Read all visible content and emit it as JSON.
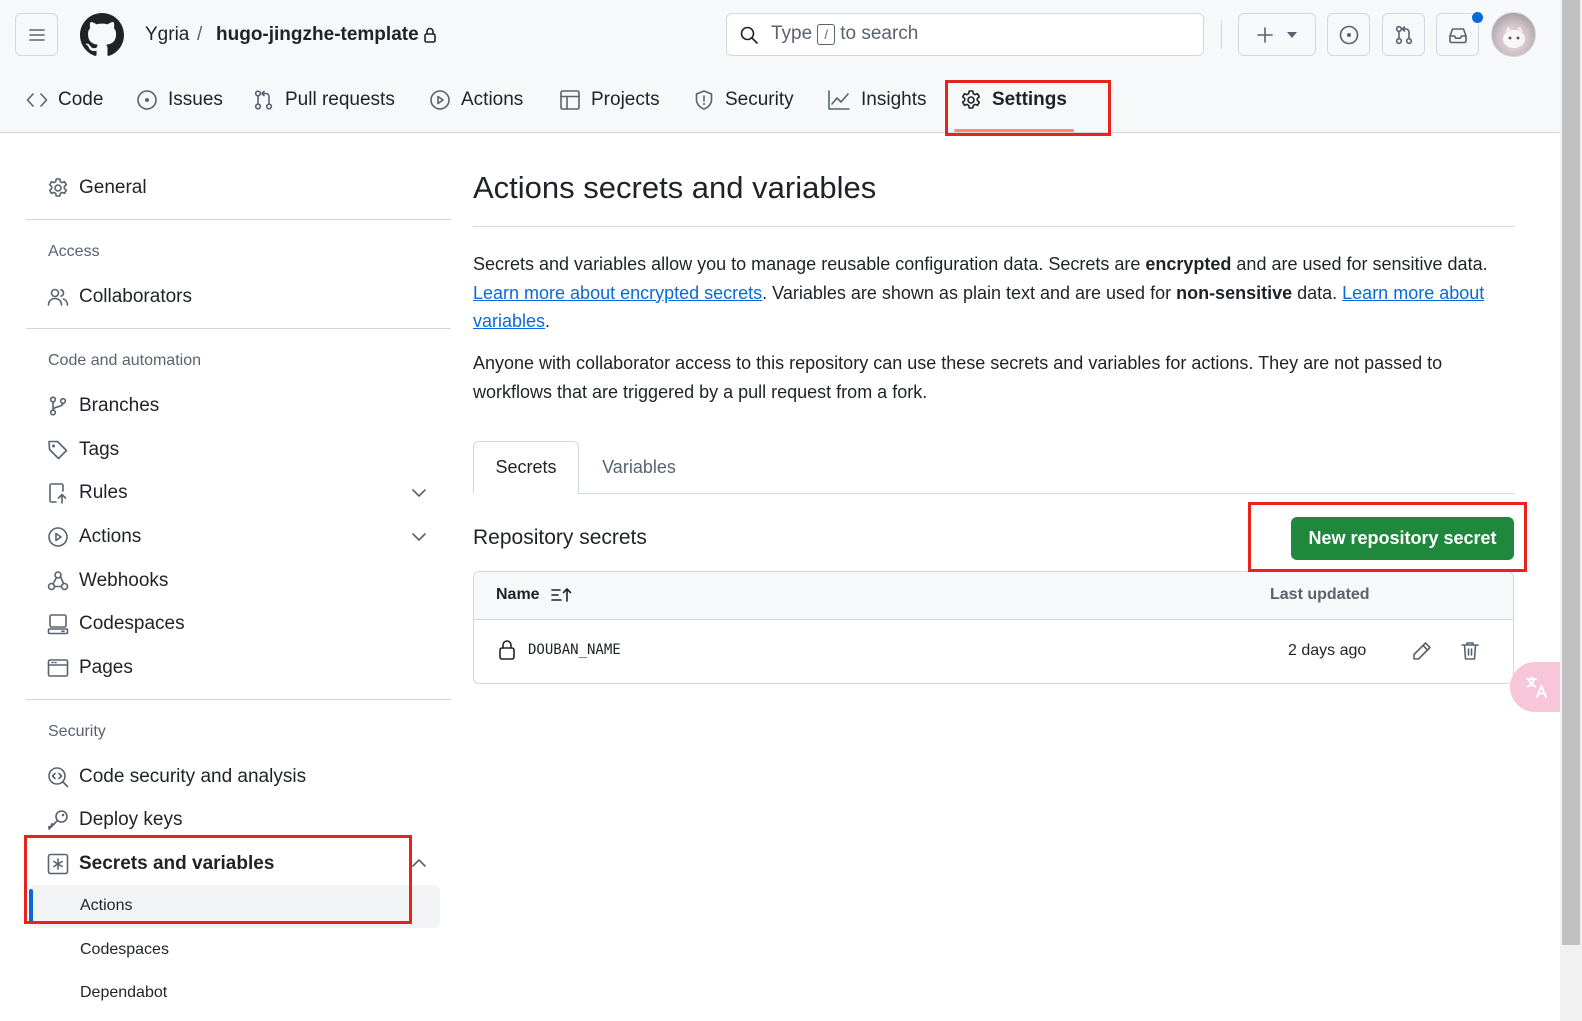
{
  "header": {
    "owner": "Ygria",
    "separator": "/",
    "repo": "hugo-jingzhe-template",
    "search": {
      "prefix": "Type",
      "key": "/",
      "suffix": "to search"
    }
  },
  "repo_nav": {
    "tabs": [
      {
        "label": "Code"
      },
      {
        "label": "Issues"
      },
      {
        "label": "Pull requests"
      },
      {
        "label": "Actions"
      },
      {
        "label": "Projects"
      },
      {
        "label": "Security"
      },
      {
        "label": "Insights"
      },
      {
        "label": "Settings"
      }
    ],
    "active": "Settings"
  },
  "sidebar": {
    "general": "General",
    "access_heading": "Access",
    "collaborators": "Collaborators",
    "code_heading": "Code and automation",
    "branches": "Branches",
    "tags": "Tags",
    "rules": "Rules",
    "actions": "Actions",
    "webhooks": "Webhooks",
    "codespaces": "Codespaces",
    "pages": "Pages",
    "security_heading": "Security",
    "code_security": "Code security and analysis",
    "deploy_keys": "Deploy keys",
    "secrets": "Secrets and variables",
    "sub_actions": "Actions",
    "sub_codespaces": "Codespaces",
    "sub_dependabot": "Dependabot"
  },
  "main": {
    "title": "Actions secrets and variables",
    "p1": {
      "t1": "Secrets and variables allow you to manage reusable configuration data. Secrets are ",
      "b1": "encrypted",
      "t2": " and are used for sensitive data. ",
      "link1": "Learn more about encrypted secrets",
      "t3": ". Variables are shown as plain text and are used for ",
      "b2": "non-sensitive",
      "t4": " data. ",
      "link2": "Learn more about variables",
      "t5": "."
    },
    "p2": "Anyone with collaborator access to this repository can use these secrets and variables for actions. They are not passed to workflows that are triggered by a pull request from a fork.",
    "tabs": [
      "Secrets",
      "Variables"
    ],
    "active_tab": "Secrets",
    "section_title": "Repository secrets",
    "new_button": "New repository secret",
    "table": {
      "col_name": "Name",
      "col_updated": "Last updated",
      "rows": [
        {
          "name": "DOUBAN_NAME",
          "updated": "2 days ago"
        }
      ]
    }
  },
  "colors": {
    "accent_green": "#1f883d",
    "link_blue": "#0969da",
    "highlight_red": "#e8231c",
    "notification_blue": "#0969da"
  }
}
